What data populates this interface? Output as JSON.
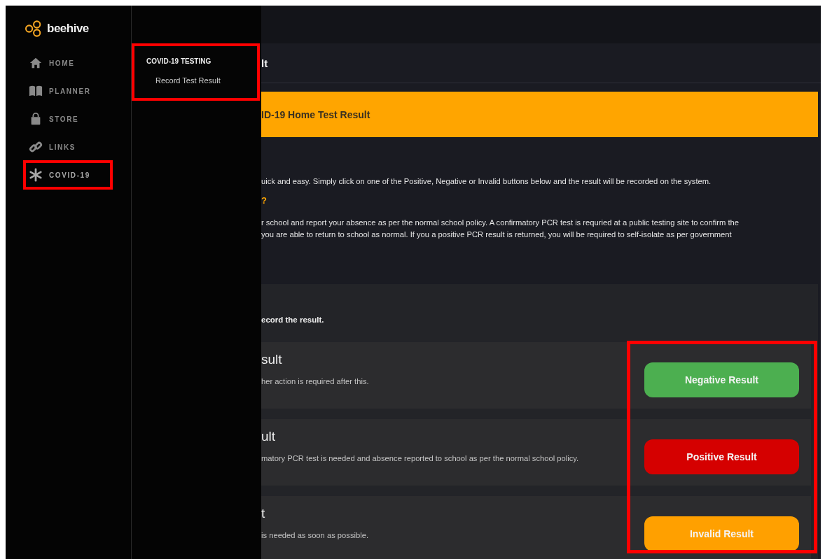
{
  "logo": {
    "text": "beehive"
  },
  "nav": [
    {
      "label": "HOME",
      "selected": false,
      "highlighted": false
    },
    {
      "label": "PLANNER",
      "selected": false,
      "highlighted": false
    },
    {
      "label": "STORE",
      "selected": false,
      "highlighted": false
    },
    {
      "label": "LINKS",
      "selected": false,
      "highlighted": false
    },
    {
      "label": "COVID-19",
      "selected": true,
      "highlighted": true
    }
  ],
  "submenu": {
    "title": "COVID-19 TESTING",
    "item": "Record Test Result",
    "highlighted": true
  },
  "page_title": "lt",
  "banner": "ID-19 Home Test Result",
  "intro": "uick and easy. Simply click on one of the Positive, Negative or Invalid buttons below and the result will be recorded on the system.",
  "question": "?",
  "details": [
    "r school and report your absence as per the normal school policy. A confirmatory PCR test is requried at a public testing site to confirm the",
    "you are able to return to school as normal. If you a positive PCR result is returned, you will be required to self-isolate as per government"
  ],
  "record_hint": "ecord the result.",
  "results_highlighted": true,
  "results": [
    {
      "title": "sult",
      "description": "her action is required after this.",
      "button": "Negative Result",
      "kind": "negative"
    },
    {
      "title": "ult",
      "description": "matory PCR test is needed and absence reported to school as per the normal school policy.",
      "button": "Positive Result",
      "kind": "positive"
    },
    {
      "title": "t",
      "description": "is needed as soon as possible.",
      "button": "Invalid Result",
      "kind": "invalid"
    }
  ]
}
